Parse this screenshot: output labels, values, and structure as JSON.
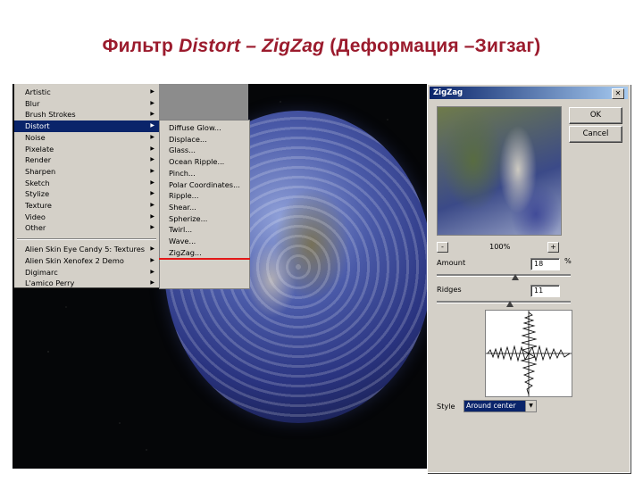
{
  "slide": {
    "title_part1": "Фильтр ",
    "title_part2": "Distort – ZigZag",
    "title_part3": " (Деформация –Зигзаг)",
    "title_color": "#9b1b2d"
  },
  "menu": {
    "items": [
      {
        "label": "Artistic",
        "arrow": "▶"
      },
      {
        "label": "Blur",
        "arrow": "▶"
      },
      {
        "label": "Brush Strokes",
        "arrow": "▶"
      },
      {
        "label": "Distort",
        "arrow": "▶",
        "selected": true
      },
      {
        "label": "Noise",
        "arrow": "▶"
      },
      {
        "label": "Pixelate",
        "arrow": "▶"
      },
      {
        "label": "Render",
        "arrow": "▶"
      },
      {
        "label": "Sharpen",
        "arrow": "▶"
      },
      {
        "label": "Sketch",
        "arrow": "▶"
      },
      {
        "label": "Stylize",
        "arrow": "▶"
      },
      {
        "label": "Texture",
        "arrow": "▶"
      },
      {
        "label": "Video",
        "arrow": "▶"
      },
      {
        "label": "Other",
        "arrow": "▶"
      }
    ],
    "plugins": [
      {
        "label": "Alien Skin Eye Candy 5: Textures",
        "arrow": "▶"
      },
      {
        "label": "Alien Skin Xenofex 2 Demo",
        "arrow": "▶"
      },
      {
        "label": "Digimarc",
        "arrow": "▶"
      },
      {
        "label": "L'amico Perry",
        "arrow": "▶"
      }
    ],
    "highlight_color": "#0a246a"
  },
  "submenu": {
    "items": [
      "Diffuse Glow...",
      "Displace...",
      "Glass...",
      "Ocean Ripple...",
      "Pinch...",
      "Polar Coordinates...",
      "Ripple...",
      "Shear...",
      "Spherize...",
      "Twirl...",
      "Wave...",
      "ZigZag..."
    ],
    "marker_color": "#e21818"
  },
  "dialog": {
    "title": "ZigZag",
    "close": "✕",
    "ok": "OK",
    "cancel": "Cancel",
    "zoom_out": "-",
    "zoom_in": "+",
    "zoom": "100%",
    "amount_label": "Amount",
    "amount_value": "18",
    "amount_unit": "%",
    "ridges_label": "Ridges",
    "ridges_value": "11",
    "style_label": "Style",
    "style_value": "Around center",
    "style_arrow": "▼"
  }
}
